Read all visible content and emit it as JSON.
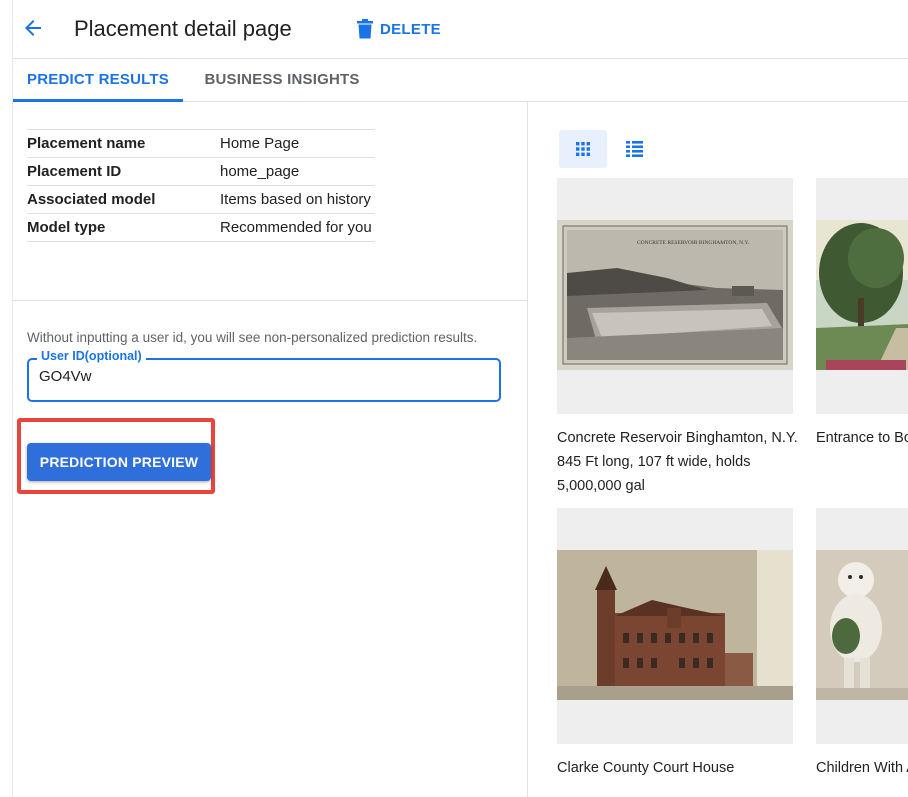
{
  "header": {
    "title": "Placement detail page",
    "delete_label": "DELETE"
  },
  "tabs": [
    {
      "label": "PREDICT RESULTS",
      "active": true
    },
    {
      "label": "BUSINESS INSIGHTS",
      "active": false
    }
  ],
  "placement_info": [
    {
      "key": "Placement name",
      "value": "Home Page"
    },
    {
      "key": "Placement ID",
      "value": "home_page"
    },
    {
      "key": "Associated model",
      "value": "Items based on history"
    },
    {
      "key": "Model type",
      "value": "Recommended for you"
    }
  ],
  "prediction": {
    "hint": "Without inputting a user id, you will see non-personalized prediction results.",
    "user_id_label": "User ID(optional)",
    "user_id_value": "GO4Vw",
    "button_label": "PREDICTION PREVIEW"
  },
  "results": {
    "items": [
      {
        "title": "Concrete Reservoir Binghamton, N.Y. 845 Ft long, 107 ft wide, holds 5,000,000 gal",
        "postcard_caption": "CONCRETE RESERVOIR BINGHAMTON, N.Y."
      },
      {
        "title": "Entrance to Bo Golf Links"
      },
      {
        "title": "Clarke County Court House"
      },
      {
        "title": "Children With Annee"
      }
    ]
  },
  "colors": {
    "accent": "#1a73e8",
    "button": "#2f6fdb",
    "highlight": "#e8453c",
    "divider": "#e0e0e0"
  },
  "icons": {
    "back": "arrow-left-icon",
    "delete": "trash-icon",
    "grid_view": "grid-view-icon",
    "list_view": "list-view-icon"
  }
}
